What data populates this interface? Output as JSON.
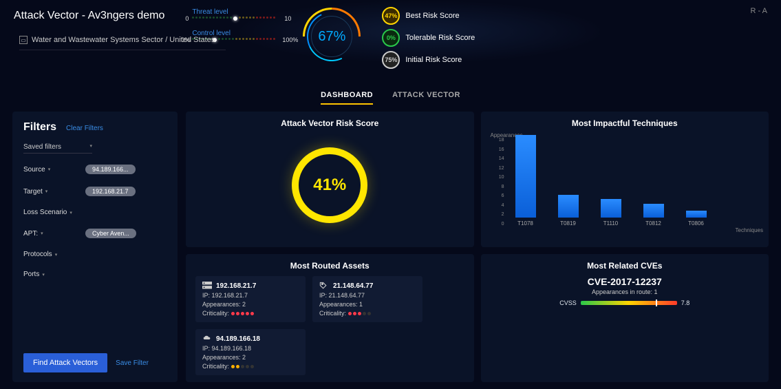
{
  "header": {
    "title": "Attack Vector  -  Av3ngers demo",
    "ra": "R - A",
    "breadcrumb": "Water and Wastewater Systems Sector / United States",
    "threat": {
      "label": "Threat level",
      "min": "0",
      "max": "10"
    },
    "control": {
      "label": "Control level",
      "min": "0%",
      "max": "100%"
    },
    "gauge_value": "67%",
    "scores": [
      {
        "pct": "47%",
        "label": "Best Risk Score",
        "fg": "#ffd400",
        "bg": "#3a2a00"
      },
      {
        "pct": "0%",
        "label": "Tolerable Risk Score",
        "fg": "#2ac84a",
        "bg": "#0a2a10"
      },
      {
        "pct": "75%",
        "label": "Initial Risk Score",
        "fg": "#ccc",
        "bg": "#222"
      }
    ]
  },
  "tabs": {
    "dashboard": "DASHBOARD",
    "attack": "ATTACK VECTOR"
  },
  "filters": {
    "title": "Filters",
    "clear": "Clear Filters",
    "saved": "Saved filters",
    "rows": [
      {
        "label": "Source",
        "pill": "94.189.166..."
      },
      {
        "label": "Target",
        "pill": "192.168.21.7"
      },
      {
        "label": "Loss Scenario",
        "pill": ""
      },
      {
        "label": "APT:",
        "pill": "Cyber Aven..."
      },
      {
        "label": "Protocols",
        "pill": ""
      },
      {
        "label": "Ports",
        "pill": ""
      }
    ],
    "find_btn": "Find Attack Vectors",
    "save_filter": "Save Filter"
  },
  "cards": {
    "risk": {
      "title": "Attack Vector Risk Score",
      "value": "41%"
    },
    "techniques": {
      "title": "Most Impactful Techniques",
      "ylabel": "Appearances",
      "xlabel": "Techniques"
    },
    "assets": {
      "title": "Most Routed Assets",
      "items": [
        {
          "name": "192.168.21.7",
          "ip": "IP:  192.168.21.7",
          "app": "Appearances:  2",
          "crit": 5,
          "color": "red",
          "icon": "server"
        },
        {
          "name": "21.148.64.77",
          "ip": "IP:  21.148.64.77",
          "app": "Appearances:  1",
          "crit": 3,
          "color": "red",
          "icon": "tag"
        },
        {
          "name": "94.189.166.18",
          "ip": "IP:  94.189.166.18",
          "app": "Appearances:  2",
          "crit": 2,
          "color": "orange",
          "icon": "cloud"
        }
      ]
    },
    "cves": {
      "title": "Most Related CVEs",
      "id": "CVE-2017-12237",
      "sub": "Appearances in route: 1",
      "cvss_label": "CVSS",
      "cvss": "7.8"
    }
  },
  "chart_data": {
    "type": "bar",
    "title": "Most Impactful Techniques",
    "xlabel": "Techniques",
    "ylabel": "Appearances",
    "ylim": [
      0,
      18
    ],
    "yticks": [
      "18",
      "16",
      "14",
      "12",
      "10",
      "8",
      "6",
      "4",
      "2",
      "0"
    ],
    "categories": [
      "T1078",
      "T0819",
      "T1110",
      "T0812",
      "T0806"
    ],
    "values": [
      18,
      5,
      4,
      3,
      1.5
    ]
  }
}
